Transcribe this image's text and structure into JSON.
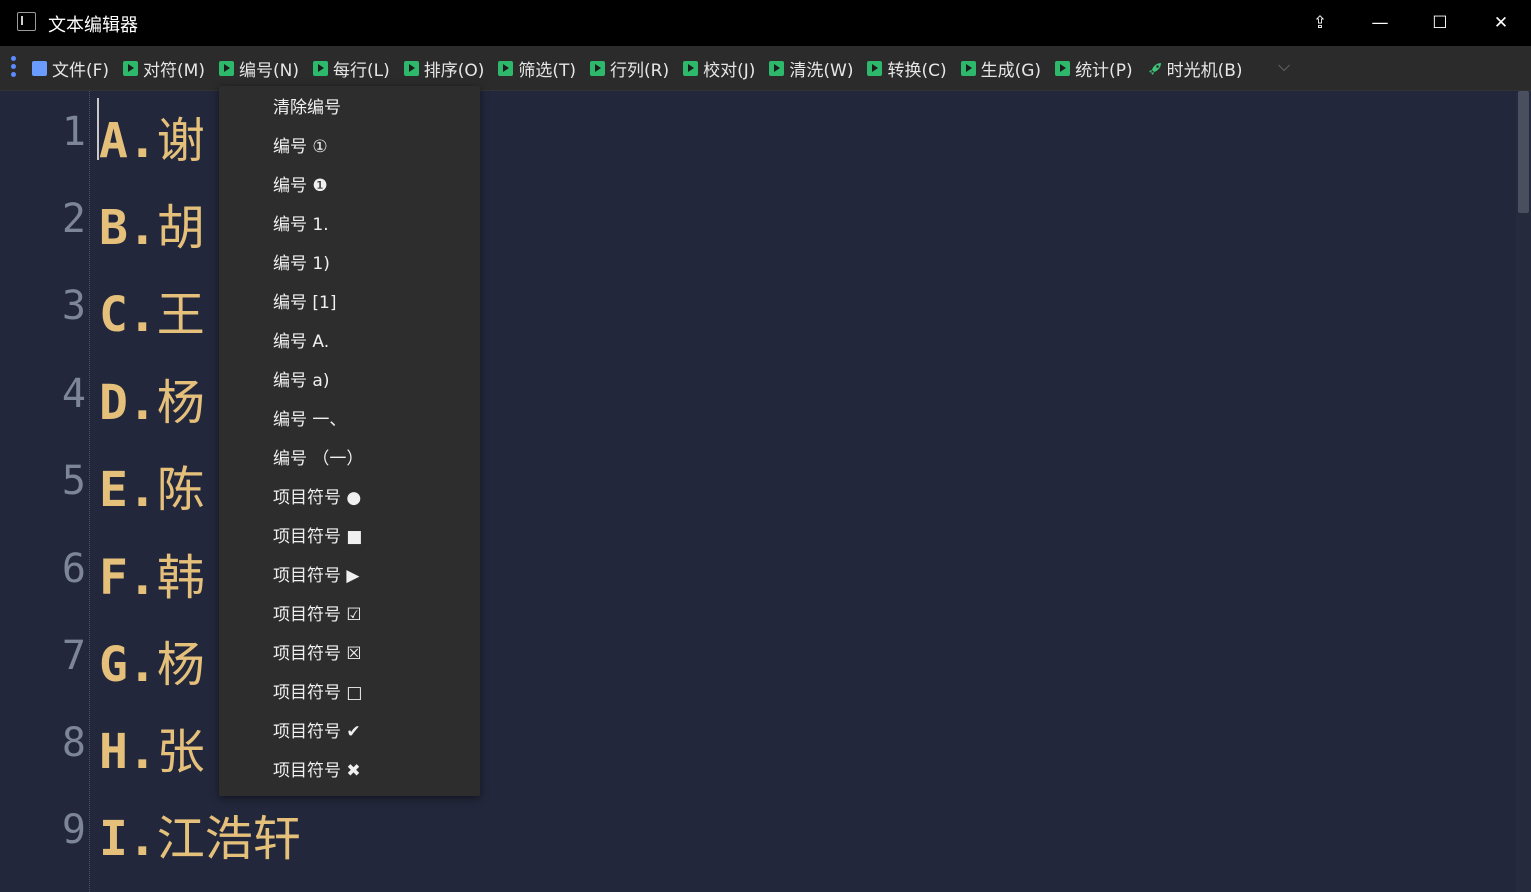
{
  "window": {
    "title": "文本编辑器",
    "buttons": {
      "pin": "⇪",
      "minimize": "—",
      "maximize": "☐",
      "close": "✕"
    }
  },
  "menubar": {
    "items": [
      {
        "label": "文件(F)",
        "icon": "file-icon"
      },
      {
        "label": "对符(M)",
        "icon": "play-icon"
      },
      {
        "label": "编号(N)",
        "icon": "play-icon"
      },
      {
        "label": "每行(L)",
        "icon": "play-icon"
      },
      {
        "label": "排序(O)",
        "icon": "play-icon"
      },
      {
        "label": "筛选(T)",
        "icon": "play-icon"
      },
      {
        "label": "行列(R)",
        "icon": "play-icon"
      },
      {
        "label": "校对(J)",
        "icon": "play-icon"
      },
      {
        "label": "清洗(W)",
        "icon": "play-icon"
      },
      {
        "label": "转换(C)",
        "icon": "play-icon"
      },
      {
        "label": "生成(G)",
        "icon": "play-icon"
      },
      {
        "label": "统计(P)",
        "icon": "play-icon"
      },
      {
        "label": "时光机(B)",
        "icon": "rocket-icon"
      }
    ],
    "expand": "⌵"
  },
  "editor": {
    "lines": [
      {
        "no": "1",
        "marker": "A.",
        "text": "谢"
      },
      {
        "no": "2",
        "marker": "B.",
        "text": "胡"
      },
      {
        "no": "3",
        "marker": "C.",
        "text": "王"
      },
      {
        "no": "4",
        "marker": "D.",
        "text": "杨"
      },
      {
        "no": "5",
        "marker": "E.",
        "text": "陈"
      },
      {
        "no": "6",
        "marker": "F.",
        "text": "韩"
      },
      {
        "no": "7",
        "marker": "G.",
        "text": "杨"
      },
      {
        "no": "8",
        "marker": "H.",
        "text": "张"
      },
      {
        "no": "9",
        "marker": "I.",
        "text": "江浩轩"
      }
    ]
  },
  "numbering_menu": {
    "items": [
      {
        "label": "清除编号",
        "symbol": ""
      },
      {
        "label": "编号",
        "symbol": "①"
      },
      {
        "label": "编号",
        "symbol": "❶"
      },
      {
        "label": "编号",
        "symbol": "1."
      },
      {
        "label": "编号",
        "symbol": "1)"
      },
      {
        "label": "编号",
        "symbol": "[1]"
      },
      {
        "label": "编号",
        "symbol": "A."
      },
      {
        "label": "编号",
        "symbol": "a)"
      },
      {
        "label": "编号",
        "symbol": "一、"
      },
      {
        "label": "编号",
        "symbol": "（一）"
      },
      {
        "label": "项目符号",
        "symbol": "●"
      },
      {
        "label": "项目符号",
        "symbol": "■"
      },
      {
        "label": "项目符号",
        "symbol": "▶"
      },
      {
        "label": "项目符号",
        "symbol": "☑"
      },
      {
        "label": "项目符号",
        "symbol": "☒"
      },
      {
        "label": "项目符号",
        "symbol": "□"
      },
      {
        "label": "项目符号",
        "symbol": "✔"
      },
      {
        "label": "项目符号",
        "symbol": "✖"
      }
    ]
  }
}
